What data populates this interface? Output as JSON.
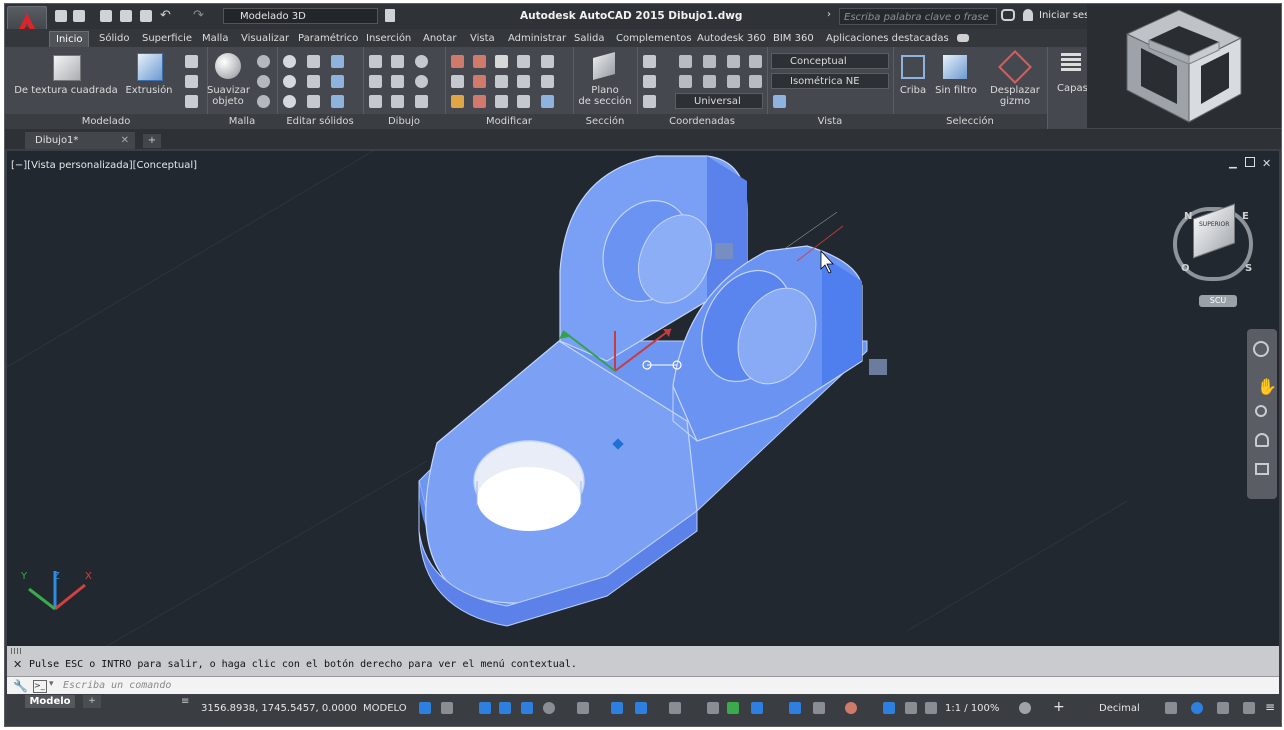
{
  "title_bar": {
    "workspace": "Modelado 3D",
    "title": "Autodesk AutoCAD 2015   Dibujo1.dwg",
    "search_placeholder": "Escriba palabra clave o frase",
    "signin": "Iniciar sesi"
  },
  "ribbon_tabs": [
    "Inicio",
    "Sólido",
    "Superficie",
    "Malla",
    "Visualizar",
    "Paramétrico",
    "Inserción",
    "Anotar",
    "Vista",
    "Administrar",
    "Salida",
    "Complementos",
    "Autodesk 360",
    "BIM 360",
    "Aplicaciones destacadas"
  ],
  "ribbon": {
    "modelado": {
      "label": "Modelado",
      "btn1": "De textura cuadrada",
      "btn2": "Extrusión"
    },
    "malla": {
      "label": "Malla",
      "btn1a": "Suavizar",
      "btn1b": "objeto"
    },
    "editar": {
      "label": "Editar sólidos"
    },
    "dibujo": {
      "label": "Dibujo"
    },
    "modificar": {
      "label": "Modificar"
    },
    "seccion": {
      "label": "Sección",
      "btn1a": "Plano",
      "btn1b": "de sección"
    },
    "coordenadas": {
      "label": "Coordenadas",
      "ucs": "Universal"
    },
    "vista": {
      "label": "Vista",
      "style": "Conceptual",
      "view": "Isométrica NE"
    },
    "seleccion": {
      "label": "Selección",
      "criba": "Criba",
      "filtro": "Sin filtro",
      "gizmo_a": "Desplazar",
      "gizmo_b": "gizmo"
    },
    "capas": {
      "label": "Capas"
    }
  },
  "doc_tab": "Dibujo1*",
  "viewport": {
    "label": "[−][Vista personalizada][Conceptual]",
    "scu": "SCU",
    "navcube": {
      "top": "SUPERIOR",
      "n": "N",
      "e": "E",
      "s": "S",
      "o": "O"
    }
  },
  "command": {
    "history": "Pulse ESC o INTRO para salir, o haga clic con el botón derecho para ver el menú contextual.",
    "placeholder": "Escriba un comando"
  },
  "status": {
    "model_tab": "Modelo",
    "coords": "3156.8938, 1745.5457, 0.0000",
    "space": "MODELO",
    "scale": "1:1 / 100%",
    "units": "Decimal"
  },
  "colors": {
    "accent": "#1e70d4",
    "model_blue": "#4f7fef",
    "viewport_bg": "#212830",
    "cmd_bg": "#c9cbce"
  }
}
